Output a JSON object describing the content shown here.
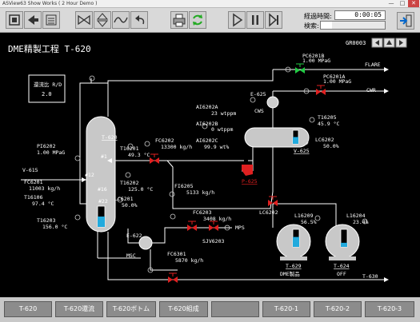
{
  "window": {
    "title": "ASView63 Show Works ( 2 Hour Demo )",
    "min": "—",
    "max": "□",
    "close": "✕"
  },
  "toolbar": {
    "elapsed_label": "経過時間:",
    "elapsed_value": "0:00:05",
    "search_label": "検索:",
    "search_value": ""
  },
  "plant": {
    "title": "DME精製工程 T-620",
    "group": "GR0003",
    "reflux": {
      "label": "還流比 R/D",
      "value": "2.0"
    },
    "tags": {
      "pc6201b": {
        "tag": "PC6201B",
        "value": "1.00 MPaG"
      },
      "pc6201a": {
        "tag": "PC6201A",
        "value": "1.00 MPaG"
      },
      "flare": "FLARE",
      "cwr": "CWR",
      "e625": "E-625",
      "cws": "CWS",
      "ai6202a": {
        "tag": "AI6202A",
        "value": "23 wtppm"
      },
      "ai6202b": {
        "tag": "AI6202B",
        "value": "0 wtppm"
      },
      "ai6202c": {
        "tag": "AI6202C",
        "value": "99.9 wt%"
      },
      "t16205": {
        "tag": "T16205",
        "value": "45.9 °C"
      },
      "lc6202_top": {
        "tag": "LC6202",
        "value": "50.0%"
      },
      "v625": "V-625",
      "p625": "P-625",
      "t620": "T-620",
      "pi6202": {
        "tag": "PI6202",
        "value": "1.00 MPaG"
      },
      "t16201": {
        "tag": "T16201",
        "value": "49.3 °C"
      },
      "fc6202": {
        "tag": "FC6202",
        "value": "13300 kg/h"
      },
      "v615": "V-615",
      "tray1": "#1",
      "tray12": "#12",
      "tray16": "#16",
      "tray22": "#22",
      "fc6201": {
        "tag": "FC6201",
        "value": "11003 kg/h"
      },
      "t16106": {
        "tag": "T16106",
        "value": "97.4 °C"
      },
      "t16202": {
        "tag": "T16202",
        "value": "125.0 °C"
      },
      "lc6201": {
        "tag": "LC6201",
        "value": "50.0%"
      },
      "fi6205": {
        "tag": "FI6205",
        "value": "5133 kg/h"
      },
      "lc6202_mid": "LC6202",
      "t16203": {
        "tag": "T16203",
        "value": "156.0 °C"
      },
      "fc6203": {
        "tag": "FC6203",
        "value": "3408 kg/h"
      },
      "sjv6203": "SJV6203",
      "mps": "MPS",
      "e622": "E-622",
      "msc": "MSC",
      "fc6301": {
        "tag": "FC6301",
        "value": "5870 kg/h"
      },
      "l16209": {
        "tag": "L16209",
        "value": "56.5%"
      },
      "l16204": {
        "tag": "L16204",
        "value": "23.4%"
      },
      "t629": "T-629",
      "t624": "T-624",
      "dme": "DME製品",
      "off": "OFF",
      "t630": "T-630"
    },
    "levels": {
      "v625": 0.5,
      "t620": 0.5,
      "t629": 0.565,
      "t624": 0.234
    }
  },
  "nav": [
    "T-620",
    "T-620還流",
    "T-620ボトム",
    "T-620組成",
    "",
    "T-620-1",
    "T-620-2",
    "T-620-3"
  ]
}
